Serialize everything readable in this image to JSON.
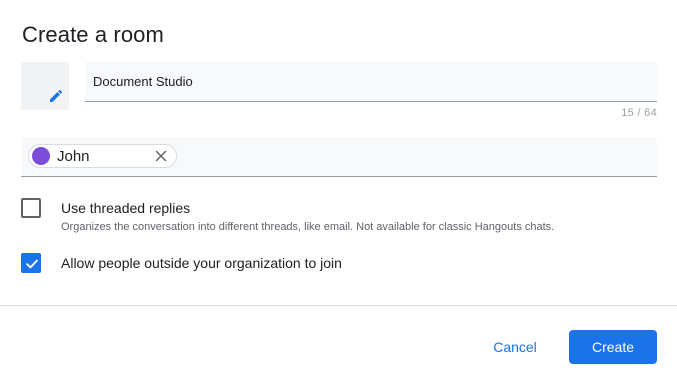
{
  "dialog": {
    "title": "Create a room"
  },
  "room_name": {
    "value": "Document Studio",
    "counter": "15 / 64"
  },
  "people": {
    "chips": [
      {
        "name": "John",
        "avatar_color": "#7c4dd8"
      }
    ]
  },
  "options": {
    "threaded": {
      "label": "Use threaded replies",
      "description": "Organizes the conversation into different threads, like email. Not available for classic Hangouts chats.",
      "checked": false
    },
    "external": {
      "label": "Allow people outside your organization to join",
      "checked": true
    }
  },
  "actions": {
    "cancel_label": "Cancel",
    "create_label": "Create"
  },
  "colors": {
    "accent": "#1a73e8",
    "field_bg": "#f8f9fa"
  },
  "icons": {
    "edit": "pencil-icon",
    "remove_chip": "close-icon",
    "check": "check-icon"
  }
}
